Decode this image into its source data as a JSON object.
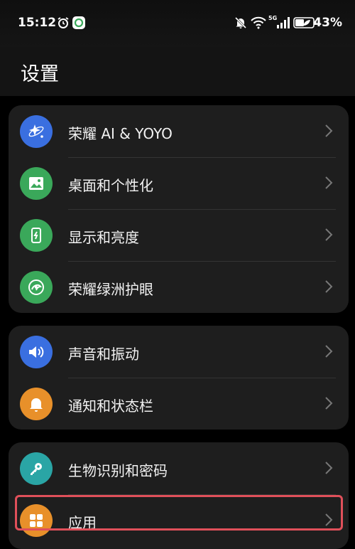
{
  "status": {
    "time": "15:12",
    "battery": "43%",
    "network": "5G"
  },
  "header": {
    "title": "设置"
  },
  "groups": [
    {
      "items": [
        {
          "label": "荣耀 AI & YOYO",
          "icon": "sparkle-icon",
          "color": "#3a6fe0"
        },
        {
          "label": "桌面和个性化",
          "icon": "image-icon",
          "color": "#3aa85a"
        },
        {
          "label": "显示和亮度",
          "icon": "phone-brightness-icon",
          "color": "#3aa85a"
        },
        {
          "label": "荣耀绿洲护眼",
          "icon": "eye-comfort-icon",
          "color": "#3aa85a"
        }
      ]
    },
    {
      "items": [
        {
          "label": "声音和振动",
          "icon": "speaker-icon",
          "color": "#3a6fe0"
        },
        {
          "label": "通知和状态栏",
          "icon": "bell-icon",
          "color": "#e8902a"
        }
      ]
    },
    {
      "items": [
        {
          "label": "生物识别和密码",
          "icon": "key-icon",
          "color": "#2aa5a5"
        },
        {
          "label": "应用",
          "icon": "apps-grid-icon",
          "color": "#e8902a"
        }
      ]
    }
  ]
}
